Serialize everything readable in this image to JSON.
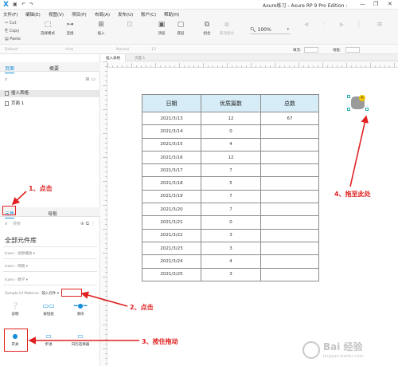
{
  "titlebar": {
    "logo": "X",
    "title": "Axure练习 - Axure RP 9 Pro Edition :",
    "min": "—",
    "max": "❐",
    "close": "✕"
  },
  "menu": [
    "文件(F)",
    "编辑(E)",
    "视图(V)",
    "项目(P)",
    "布局(A)",
    "发布(U)",
    "账户(C)",
    "帮助(H)"
  ],
  "clipboard": {
    "cut": "Cut",
    "copy": "Copy",
    "paste": "Paste"
  },
  "ribbon": {
    "select_mode": "选择模式",
    "connect": "连接",
    "insert": "插入",
    "top": "顶层",
    "bottom": "底层",
    "group": "组合",
    "ungroup": "取消组合",
    "zoom": "100%"
  },
  "stylebar": {
    "style": "Default",
    "font": "Arial",
    "weight": "Normal",
    "size": "13",
    "fill_label": "填充:",
    "border_label": "线框:"
  },
  "pages_panel": {
    "tab_pages": "页面",
    "tab_outline": "概要",
    "items": [
      "插入表格",
      "页面 1"
    ]
  },
  "library_panel": {
    "tab_widgets": "元件",
    "tab_masters": "母板",
    "search_placeholder": "搜索",
    "library_name": "全部元件库",
    "groups": [
      "Icons - 视频播放 ▾",
      "Icons - 网络 ▾",
      "Icons - 数学 ▾"
    ],
    "section": "Sample UI Patterns",
    "section_sub": "输入控件 ▾",
    "widgets": [
      "说明",
      "按钮组",
      "滑块",
      "开关",
      "步进",
      "日历选择器"
    ]
  },
  "doctabs": [
    "插入表格",
    "页面 1"
  ],
  "table": {
    "headers": [
      "日期",
      "优质篇数",
      "总数"
    ],
    "rows": [
      [
        "2021/3/13",
        "12",
        "67"
      ],
      [
        "2021/3/14",
        "0",
        ""
      ],
      [
        "2021/3/15",
        "4",
        ""
      ],
      [
        "2021/3/16",
        "12",
        ""
      ],
      [
        "2021/3/17",
        "7",
        ""
      ],
      [
        "2021/3/18",
        "5",
        ""
      ],
      [
        "2021/3/19",
        "7",
        ""
      ],
      [
        "2021/3/20",
        "7",
        ""
      ],
      [
        "2021/3/21",
        "0",
        ""
      ],
      [
        "2021/3/22",
        "3",
        ""
      ],
      [
        "2021/3/23",
        "3",
        ""
      ],
      [
        "2021/3/24",
        "4",
        ""
      ],
      [
        "2021/3/25",
        "3",
        ""
      ]
    ]
  },
  "annotations": {
    "step1": "1、点击",
    "step2": "2、点击",
    "step3": "3、按住拖动",
    "step4": "4、拖至此处"
  },
  "watermark": {
    "line1": "Bai 经验",
    "line2": "jingyan.baidu.com"
  },
  "colors": {
    "accent": "#1a8fd8",
    "annotation": "#e02020",
    "table_header": "#d6edf7"
  }
}
